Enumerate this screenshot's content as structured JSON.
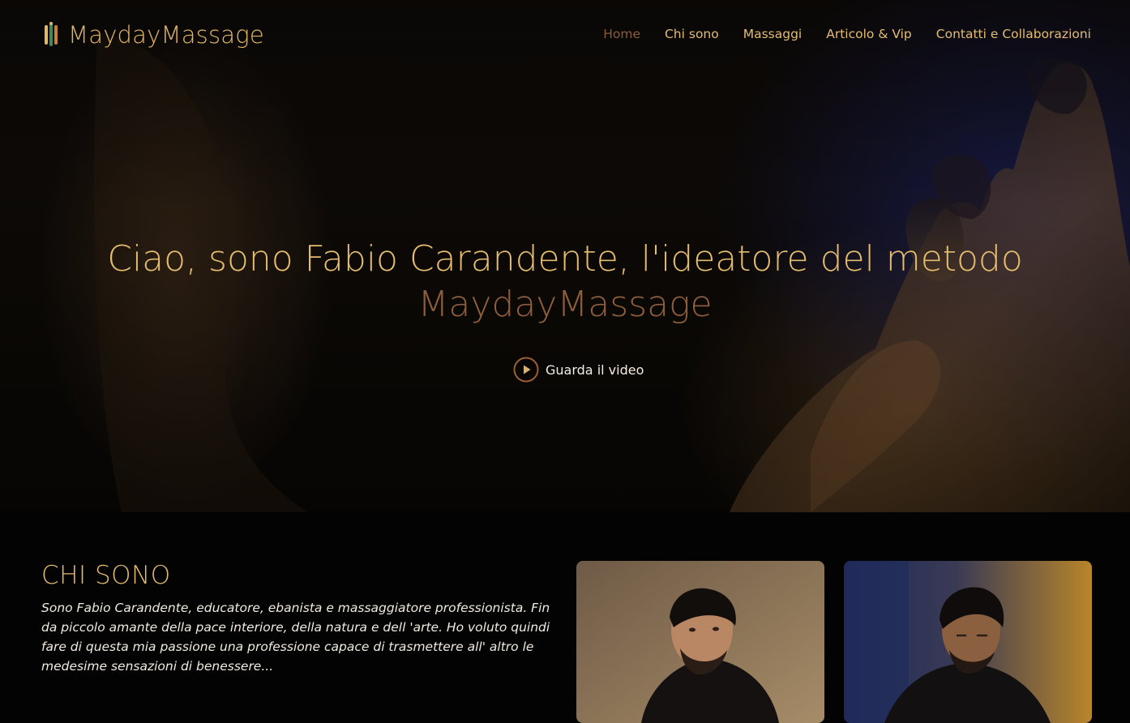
{
  "brand": {
    "name": "MaydayMassage"
  },
  "nav": {
    "items": [
      {
        "label": "Home",
        "active": true
      },
      {
        "label": "Chi sono",
        "active": false
      },
      {
        "label": "Massaggi",
        "active": false
      },
      {
        "label": "Articolo & Vip",
        "active": false
      },
      {
        "label": "Contatti e Collaborazioni",
        "active": false
      }
    ]
  },
  "hero": {
    "title": "Ciao, sono Fabio Carandente, l'ideatore del metodo",
    "brand": "MaydayMassage",
    "video_label": "Guarda il video"
  },
  "about": {
    "title": "CHI SONO",
    "text": "Sono Fabio Carandente, educatore, ebanista e massaggiatore professionista. Fin da piccolo amante della pace interiore, della natura e dell 'arte. Ho voluto quindi fare di questa mia passione una professione capace di trasmettere all' altro le medesime sensazioni di benessere..."
  },
  "colors": {
    "gold": "#e3bc6e",
    "copper": "#8f5f3d",
    "background": "#030303",
    "text": "#f0eadf"
  },
  "icons": {
    "logo": "logo-mark-icon",
    "video": "play-circle-icon"
  }
}
